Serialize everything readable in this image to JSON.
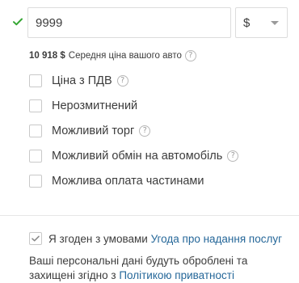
{
  "price": {
    "value": "9999",
    "currency": "$"
  },
  "avg_price": {
    "amount": "10 918 $",
    "label": "Середня ціна вашого авто",
    "help": "?"
  },
  "options": [
    {
      "label": "Ціна з ПДВ",
      "checked": false,
      "has_help": true
    },
    {
      "label": "Нерозмитнений",
      "checked": false,
      "has_help": false
    },
    {
      "label": "Можливий торг",
      "checked": false,
      "has_help": true
    },
    {
      "label": "Можливий обмін на автомобіль",
      "checked": false,
      "has_help": true
    },
    {
      "label": "Можлива оплата частинами",
      "checked": false,
      "has_help": false
    }
  ],
  "help_glyph": "?",
  "agreement": {
    "checked": true,
    "text": "Я згоден з умовами ",
    "link_text": "Угода про надання послуг"
  },
  "privacy": {
    "text": "Ваші персональні дані будуть оброблені та захищені згідно з ",
    "link_text": "Політикою приватності"
  },
  "colors": {
    "valid_check": "#35a633",
    "link": "#256799",
    "border": "#dcdcdc"
  }
}
